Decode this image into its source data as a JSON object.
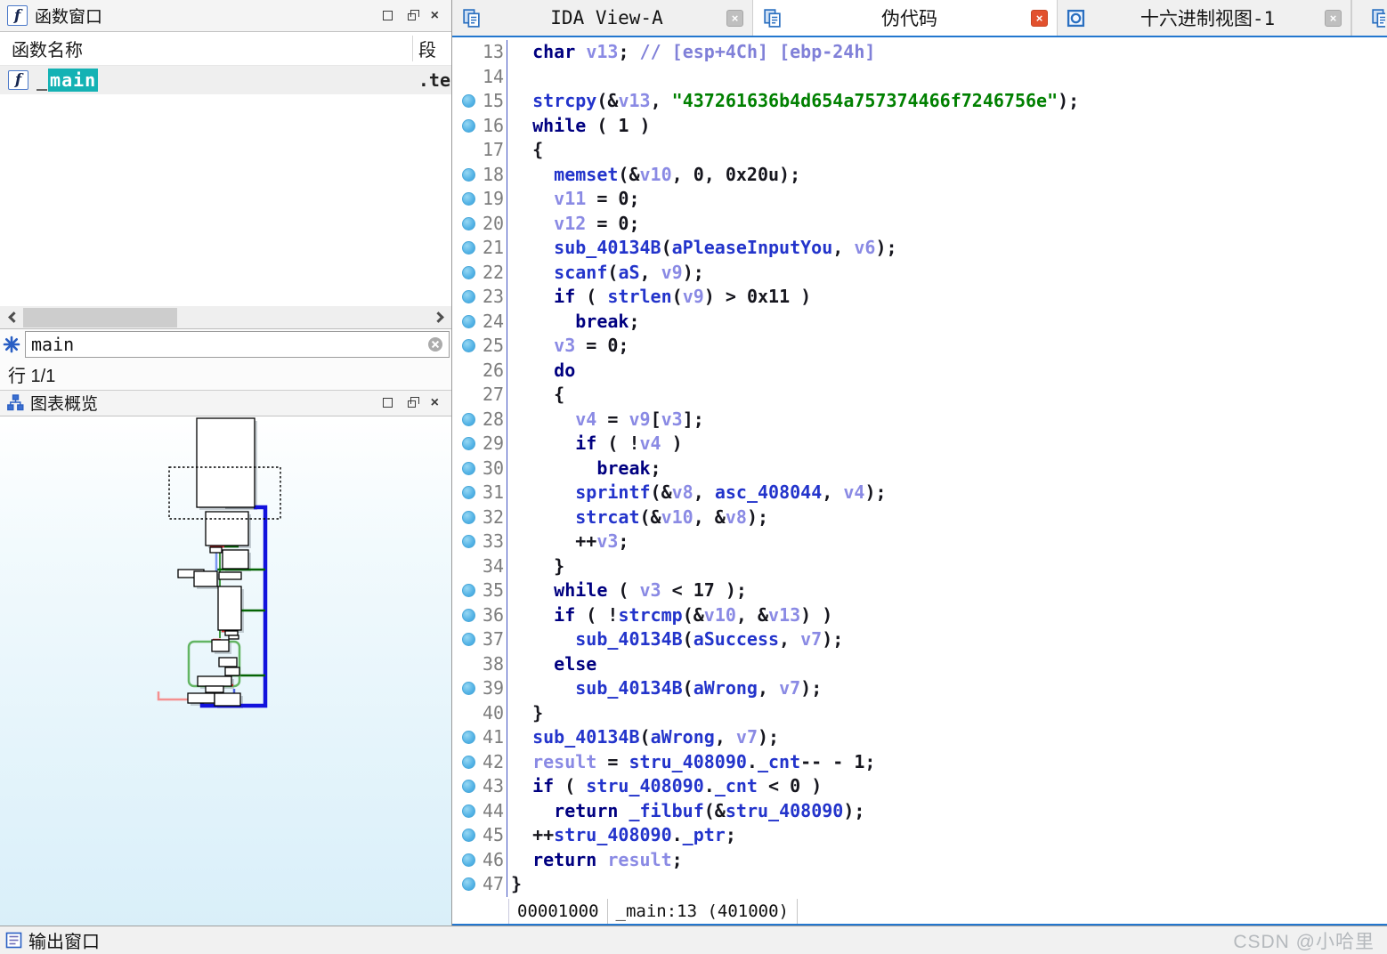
{
  "functions_panel": {
    "title": "函数窗口",
    "col_name": "函数名称",
    "col_segment": "段",
    "row": {
      "prefix": "_",
      "match": "main",
      "segment": ".te"
    },
    "search_value": "main",
    "line_counter": "行 1/1"
  },
  "graph_panel": {
    "title": "图表概览"
  },
  "output_panel": {
    "title": "输出窗口"
  },
  "watermark": "CSDN @小哈里",
  "tabs": [
    {
      "id": "tab-ida-view-a",
      "label": "IDA View-A",
      "icon": "view",
      "active": false
    },
    {
      "id": "tab-pseudocode",
      "label": "伪代码",
      "icon": "view",
      "active": true
    },
    {
      "id": "tab-hexview-1",
      "label": "十六进制视图-1",
      "icon": "hex",
      "active": false
    }
  ],
  "status_bar": {
    "address": "00001000",
    "location": "_main:13 (401000)"
  },
  "colors": {
    "keyword": "#000080",
    "function": "#2334cb",
    "variable": "#8a8ae4",
    "string": "#008000",
    "comment": "#8080d8",
    "plain": "#16161e",
    "accent_blue": "#2377cf",
    "highlight_teal": "#14b2b4",
    "breakpoint": "#55b4e6",
    "tab_close_red": "#e2512e"
  },
  "code": {
    "lines": [
      {
        "n": "13",
        "bp": false,
        "t": [
          [
            "p",
            "  "
          ],
          [
            "k",
            "char"
          ],
          [
            "p",
            " "
          ],
          [
            "v",
            "v13"
          ],
          [
            "p",
            "; "
          ],
          [
            "c",
            "// [esp+4Ch] [ebp-24h]"
          ]
        ]
      },
      {
        "n": "14",
        "bp": false,
        "t": []
      },
      {
        "n": "15",
        "bp": true,
        "t": [
          [
            "p",
            "  "
          ],
          [
            "f",
            "strcpy"
          ],
          [
            "p",
            "(&"
          ],
          [
            "v",
            "v13"
          ],
          [
            "p",
            ", "
          ],
          [
            "s",
            "\"437261636b4d654a757374466f7246756e\""
          ],
          [
            "p",
            ");"
          ]
        ]
      },
      {
        "n": "16",
        "bp": true,
        "t": [
          [
            "p",
            "  "
          ],
          [
            "k",
            "while"
          ],
          [
            "p",
            " ( 1 )"
          ]
        ]
      },
      {
        "n": "17",
        "bp": false,
        "t": [
          [
            "p",
            "  {"
          ]
        ]
      },
      {
        "n": "18",
        "bp": true,
        "t": [
          [
            "p",
            "    "
          ],
          [
            "f",
            "memset"
          ],
          [
            "p",
            "(&"
          ],
          [
            "v",
            "v10"
          ],
          [
            "p",
            ", 0, 0x20u);"
          ]
        ]
      },
      {
        "n": "19",
        "bp": true,
        "t": [
          [
            "p",
            "    "
          ],
          [
            "v",
            "v11"
          ],
          [
            "p",
            " = 0;"
          ]
        ]
      },
      {
        "n": "20",
        "bp": true,
        "t": [
          [
            "p",
            "    "
          ],
          [
            "v",
            "v12"
          ],
          [
            "p",
            " = 0;"
          ]
        ]
      },
      {
        "n": "21",
        "bp": true,
        "t": [
          [
            "p",
            "    "
          ],
          [
            "f",
            "sub_40134B"
          ],
          [
            "p",
            "("
          ],
          [
            "f",
            "aPleaseInputYou"
          ],
          [
            "p",
            ", "
          ],
          [
            "v",
            "v6"
          ],
          [
            "p",
            ");"
          ]
        ]
      },
      {
        "n": "22",
        "bp": true,
        "t": [
          [
            "p",
            "    "
          ],
          [
            "f",
            "scanf"
          ],
          [
            "p",
            "("
          ],
          [
            "f",
            "aS"
          ],
          [
            "p",
            ", "
          ],
          [
            "v",
            "v9"
          ],
          [
            "p",
            ");"
          ]
        ]
      },
      {
        "n": "23",
        "bp": true,
        "t": [
          [
            "p",
            "    "
          ],
          [
            "k",
            "if"
          ],
          [
            "p",
            " ( "
          ],
          [
            "f",
            "strlen"
          ],
          [
            "p",
            "("
          ],
          [
            "v",
            "v9"
          ],
          [
            "p",
            ") > 0x11 )"
          ]
        ]
      },
      {
        "n": "24",
        "bp": true,
        "t": [
          [
            "p",
            "      "
          ],
          [
            "k",
            "break"
          ],
          [
            "p",
            ";"
          ]
        ]
      },
      {
        "n": "25",
        "bp": true,
        "t": [
          [
            "p",
            "    "
          ],
          [
            "v",
            "v3"
          ],
          [
            "p",
            " = 0;"
          ]
        ]
      },
      {
        "n": "26",
        "bp": false,
        "t": [
          [
            "p",
            "    "
          ],
          [
            "k",
            "do"
          ]
        ]
      },
      {
        "n": "27",
        "bp": false,
        "t": [
          [
            "p",
            "    {"
          ]
        ]
      },
      {
        "n": "28",
        "bp": true,
        "t": [
          [
            "p",
            "      "
          ],
          [
            "v",
            "v4"
          ],
          [
            "p",
            " = "
          ],
          [
            "v",
            "v9"
          ],
          [
            "p",
            "["
          ],
          [
            "v",
            "v3"
          ],
          [
            "p",
            "];"
          ]
        ]
      },
      {
        "n": "29",
        "bp": true,
        "t": [
          [
            "p",
            "      "
          ],
          [
            "k",
            "if"
          ],
          [
            "p",
            " ( !"
          ],
          [
            "v",
            "v4"
          ],
          [
            "p",
            " )"
          ]
        ]
      },
      {
        "n": "30",
        "bp": true,
        "t": [
          [
            "p",
            "        "
          ],
          [
            "k",
            "break"
          ],
          [
            "p",
            ";"
          ]
        ]
      },
      {
        "n": "31",
        "bp": true,
        "t": [
          [
            "p",
            "      "
          ],
          [
            "f",
            "sprintf"
          ],
          [
            "p",
            "(&"
          ],
          [
            "v",
            "v8"
          ],
          [
            "p",
            ", "
          ],
          [
            "f",
            "asc_408044"
          ],
          [
            "p",
            ", "
          ],
          [
            "v",
            "v4"
          ],
          [
            "p",
            ");"
          ]
        ]
      },
      {
        "n": "32",
        "bp": true,
        "t": [
          [
            "p",
            "      "
          ],
          [
            "f",
            "strcat"
          ],
          [
            "p",
            "(&"
          ],
          [
            "v",
            "v10"
          ],
          [
            "p",
            ", &"
          ],
          [
            "v",
            "v8"
          ],
          [
            "p",
            ");"
          ]
        ]
      },
      {
        "n": "33",
        "bp": true,
        "t": [
          [
            "p",
            "      ++"
          ],
          [
            "v",
            "v3"
          ],
          [
            "p",
            ";"
          ]
        ]
      },
      {
        "n": "34",
        "bp": false,
        "t": [
          [
            "p",
            "    }"
          ]
        ]
      },
      {
        "n": "35",
        "bp": true,
        "t": [
          [
            "p",
            "    "
          ],
          [
            "k",
            "while"
          ],
          [
            "p",
            " ( "
          ],
          [
            "v",
            "v3"
          ],
          [
            "p",
            " < 17 );"
          ]
        ]
      },
      {
        "n": "36",
        "bp": true,
        "t": [
          [
            "p",
            "    "
          ],
          [
            "k",
            "if"
          ],
          [
            "p",
            " ( !"
          ],
          [
            "f",
            "strcmp"
          ],
          [
            "p",
            "(&"
          ],
          [
            "v",
            "v10"
          ],
          [
            "p",
            ", &"
          ],
          [
            "v",
            "v13"
          ],
          [
            "p",
            ") )"
          ]
        ]
      },
      {
        "n": "37",
        "bp": true,
        "t": [
          [
            "p",
            "      "
          ],
          [
            "f",
            "sub_40134B"
          ],
          [
            "p",
            "("
          ],
          [
            "f",
            "aSuccess"
          ],
          [
            "p",
            ", "
          ],
          [
            "v",
            "v7"
          ],
          [
            "p",
            ");"
          ]
        ]
      },
      {
        "n": "38",
        "bp": false,
        "t": [
          [
            "p",
            "    "
          ],
          [
            "k",
            "else"
          ]
        ]
      },
      {
        "n": "39",
        "bp": true,
        "t": [
          [
            "p",
            "      "
          ],
          [
            "f",
            "sub_40134B"
          ],
          [
            "p",
            "("
          ],
          [
            "f",
            "aWrong"
          ],
          [
            "p",
            ", "
          ],
          [
            "v",
            "v7"
          ],
          [
            "p",
            ");"
          ]
        ]
      },
      {
        "n": "40",
        "bp": false,
        "t": [
          [
            "p",
            "  }"
          ]
        ]
      },
      {
        "n": "41",
        "bp": true,
        "t": [
          [
            "p",
            "  "
          ],
          [
            "f",
            "sub_40134B"
          ],
          [
            "p",
            "("
          ],
          [
            "f",
            "aWrong"
          ],
          [
            "p",
            ", "
          ],
          [
            "v",
            "v7"
          ],
          [
            "p",
            ");"
          ]
        ]
      },
      {
        "n": "42",
        "bp": true,
        "t": [
          [
            "p",
            "  "
          ],
          [
            "v",
            "result"
          ],
          [
            "p",
            " = "
          ],
          [
            "f",
            "stru_408090"
          ],
          [
            "p",
            "."
          ],
          [
            "f",
            "_cnt"
          ],
          [
            "p",
            "-- - 1;"
          ]
        ]
      },
      {
        "n": "43",
        "bp": true,
        "t": [
          [
            "p",
            "  "
          ],
          [
            "k",
            "if"
          ],
          [
            "p",
            " ( "
          ],
          [
            "f",
            "stru_408090"
          ],
          [
            "p",
            "."
          ],
          [
            "f",
            "_cnt"
          ],
          [
            "p",
            " < 0 )"
          ]
        ]
      },
      {
        "n": "44",
        "bp": true,
        "t": [
          [
            "p",
            "    "
          ],
          [
            "k",
            "return"
          ],
          [
            "p",
            " "
          ],
          [
            "f",
            "_filbuf"
          ],
          [
            "p",
            "(&"
          ],
          [
            "f",
            "stru_408090"
          ],
          [
            "p",
            ");"
          ]
        ]
      },
      {
        "n": "45",
        "bp": true,
        "t": [
          [
            "p",
            "  ++"
          ],
          [
            "f",
            "stru_408090"
          ],
          [
            "p",
            "."
          ],
          [
            "f",
            "_ptr"
          ],
          [
            "p",
            ";"
          ]
        ]
      },
      {
        "n": "46",
        "bp": true,
        "t": [
          [
            "p",
            "  "
          ],
          [
            "k",
            "return"
          ],
          [
            "p",
            " "
          ],
          [
            "v",
            "result"
          ],
          [
            "p",
            ";"
          ]
        ]
      },
      {
        "n": "47",
        "bp": true,
        "t": [
          [
            "p",
            "}"
          ]
        ]
      }
    ]
  }
}
